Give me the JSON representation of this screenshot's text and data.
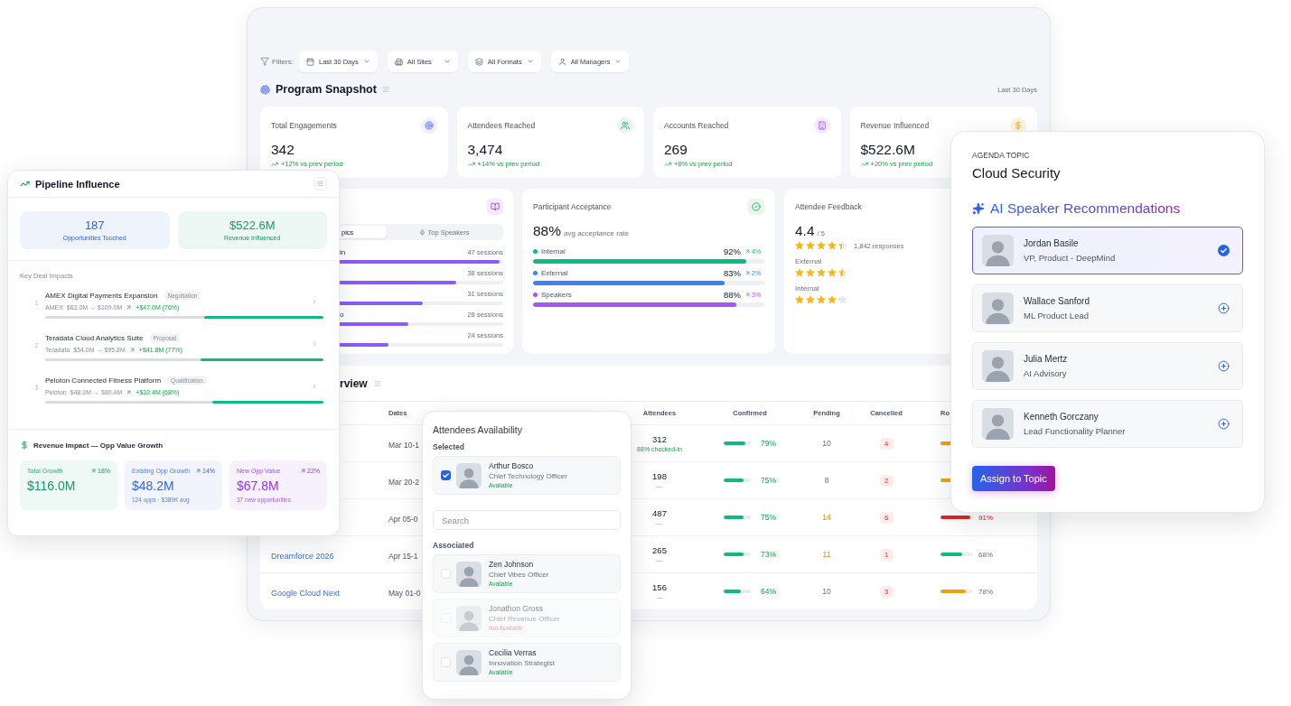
{
  "dashboard": {
    "filters": {
      "label": "Filters:",
      "items": [
        {
          "kind": "date",
          "label": "Last 30 Days"
        },
        {
          "kind": "site",
          "label": "All Sites"
        },
        {
          "kind": "format",
          "label": "All Formats"
        },
        {
          "kind": "manager",
          "label": "All Managers"
        }
      ]
    },
    "snapshot": {
      "title": "Program Snapshot",
      "period": "Last 30 Days"
    },
    "kpis": [
      {
        "kind": "engagements",
        "label": "Total Engagements",
        "value": "342",
        "trend": "+12% vs prev period"
      },
      {
        "kind": "attendees",
        "label": "Attendees Reached",
        "value": "3,474",
        "trend": "+14% vs prev period"
      },
      {
        "kind": "accounts",
        "label": "Accounts Reached",
        "value": "269",
        "trend": "+8% vs prev period"
      },
      {
        "kind": "revenue",
        "label": "Revenue Influenced",
        "value": "$522.6M",
        "trend": "+20% vs prev period"
      }
    ],
    "topics": {
      "tabs": [
        {
          "kind": "topics",
          "label": "pics",
          "selected": true
        },
        {
          "kind": "speakers",
          "label": "Top Speakers",
          "selected": false
        }
      ],
      "rows": [
        {
          "label": "in",
          "count": "47 sessions",
          "level": 0.98
        },
        {
          "count": "38 sessions",
          "level": 0.71
        },
        {
          "count": "31 sessions",
          "level": 0.51
        },
        {
          "label": "o",
          "count": "28 sessions",
          "level": 0.42
        },
        {
          "count": "24 sessions",
          "level": 0.3
        }
      ]
    },
    "acceptance": {
      "title": "Participant Acceptance",
      "value": "88%",
      "caption": "avg acceptance rate",
      "rows": [
        {
          "label": "Internal",
          "percent": "92%",
          "change": "4%",
          "color": "#10b981",
          "level": 0.92
        },
        {
          "label": "External",
          "percent": "83%",
          "change": "2%",
          "color": "#3b82f6",
          "level": 0.83
        },
        {
          "label": "Speakers",
          "percent": "88%",
          "change": "3%",
          "color": "#a855f7",
          "level": 0.88
        }
      ]
    },
    "feedback": {
      "title": "Attendee Feedback",
      "score": "4.4",
      "scale": "/ 5",
      "stars": 4.4,
      "responses": "1,842 responses",
      "groups": [
        {
          "label": "External",
          "stars": 4.5
        },
        {
          "label": "Internal",
          "stars": 4.2
        }
      ]
    },
    "overview": {
      "title": "rview",
      "columns": [
        "Dates",
        "Attendees",
        "Confirmed",
        "Pending",
        "Cancelled",
        "Ro"
      ],
      "rows": [
        {
          "date": "Mar 10-1",
          "attendees": "312",
          "note": "88% checked-in",
          "checkin": true,
          "confirmed": {
            "text": "79%",
            "level": 0.79
          },
          "pending": "10",
          "pending_flag": false,
          "cancelled": "4",
          "ro": {
            "color": "#f59e0b"
          }
        },
        {
          "date": "Mar 20-2",
          "attendees": "198",
          "note": "—",
          "checkin": false,
          "confirmed": {
            "text": "75%",
            "level": 0.75
          },
          "pending": "8",
          "pending_flag": false,
          "cancelled": "2",
          "ro": {
            "color": "#f59e0b"
          }
        },
        {
          "date": "Apr 05-0",
          "attendees": "487",
          "note": "—",
          "checkin": false,
          "confirmed": {
            "text": "75%",
            "level": 0.75
          },
          "pending": "14",
          "pending_flag": true,
          "cancelled": "6",
          "ro": {
            "level": 0.91,
            "color": "#dc2626",
            "text": "91%",
            "alert": true
          }
        },
        {
          "name": "Dreamforce 2026",
          "date": "Apr 15-1",
          "attendees": "265",
          "note": "—",
          "checkin": false,
          "confirmed": {
            "text": "73%",
            "level": 0.73
          },
          "pending": "11",
          "pending_flag": true,
          "cancelled": "1",
          "ro": {
            "level": 0.68,
            "color": "#10b981",
            "text": "68%",
            "alert": false
          }
        },
        {
          "name": "Google Cloud Next",
          "date": "May 01-0",
          "attendees": "156",
          "note": "—",
          "checkin": false,
          "confirmed": {
            "text": "64%",
            "level": 0.64
          },
          "pending": "10",
          "pending_flag": false,
          "cancelled": "3",
          "ro": {
            "level": 0.78,
            "color": "#f59e0b",
            "text": "78%",
            "alert": false
          }
        }
      ]
    }
  },
  "pipeline": {
    "title": "Pipeline Influence",
    "stats": [
      {
        "value": "187",
        "label": "Opportunities Touched",
        "color": "#3366d6"
      },
      {
        "value": "$522.6M",
        "label": "Revenue Influenced",
        "color": "#159a68"
      }
    ],
    "deals_heading": "Key Deal Impacts",
    "deals": [
      {
        "rank": "1",
        "title": "AMEX Digital Payments Expansion",
        "stage": "Negotiation",
        "company": "AMEX",
        "range": "$62.0M → $109.0M",
        "gain": "+$47.0M (76%)",
        "level": 0.43
      },
      {
        "rank": "2",
        "title": "Teradata Cloud Analytics Suite",
        "stage": "Proposal",
        "company": "Teradata",
        "range": "$54.0M → $95.8M",
        "gain": "+$41.8M (77%)",
        "level": 0.44
      },
      {
        "rank": "3",
        "title": "Peloton Connected Fitness Platform",
        "stage": "Qualification",
        "company": "Peloton",
        "range": "$48.0M → $80.4M",
        "gain": "+$32.4M (68%)",
        "level": 0.4
      }
    ],
    "impact": {
      "title": "Revenue Impact — Opp Value Growth",
      "tiles": [
        {
          "label": "Total Growth",
          "change": "18%",
          "value": "$116.0M",
          "color": "#159a68"
        },
        {
          "label": "Existing Opp Growth",
          "change": "14%",
          "value": "$48.2M",
          "note": "124 opps · $389K avg",
          "color": "#3366d6"
        },
        {
          "label": "New Opp Value",
          "change": "22%",
          "value": "$67.8M",
          "note": "37 new opportunities",
          "color": "#9333ea"
        }
      ]
    }
  },
  "availability": {
    "title": "Attendees Availability",
    "chosen": {
      "heading": "Selected",
      "people": [
        {
          "name": "Arthur Bosco",
          "role": "Chief Technology Officer",
          "status": "Available",
          "available": true,
          "checked": true
        }
      ]
    },
    "search": {
      "placeholder": "Search"
    },
    "associated": {
      "heading": "Associated",
      "people": [
        {
          "name": "Zen Johnson",
          "role": "Chief Vibes Officer",
          "status": "Available",
          "available": true,
          "checked": false
        },
        {
          "name": "Jonathon Gross",
          "role": "Chief Revenue Officer",
          "status": "Not Available",
          "available": false,
          "checked": false
        },
        {
          "name": "Cecilia Verras",
          "role": "Innovation Strategist",
          "status": "Available",
          "available": true,
          "checked": false
        }
      ]
    }
  },
  "agenda": {
    "eyebrow": "AGENDA TOPIC",
    "topic": "Cloud Security",
    "heading": "AI Speaker Recommendations",
    "speakers": [
      {
        "name": "Jordan Basile",
        "role": "VP, Product - DeepMind",
        "selected": true
      },
      {
        "name": "Wallace Sanford",
        "role": "ML Product Lead",
        "selected": false
      },
      {
        "name": "Julia Mertz",
        "role": "AI Advisory",
        "selected": false
      },
      {
        "name": "Kenneth Gorczany",
        "role": "Lead Functionality Planner",
        "selected": false
      }
    ],
    "button": "Assign to Topic"
  }
}
